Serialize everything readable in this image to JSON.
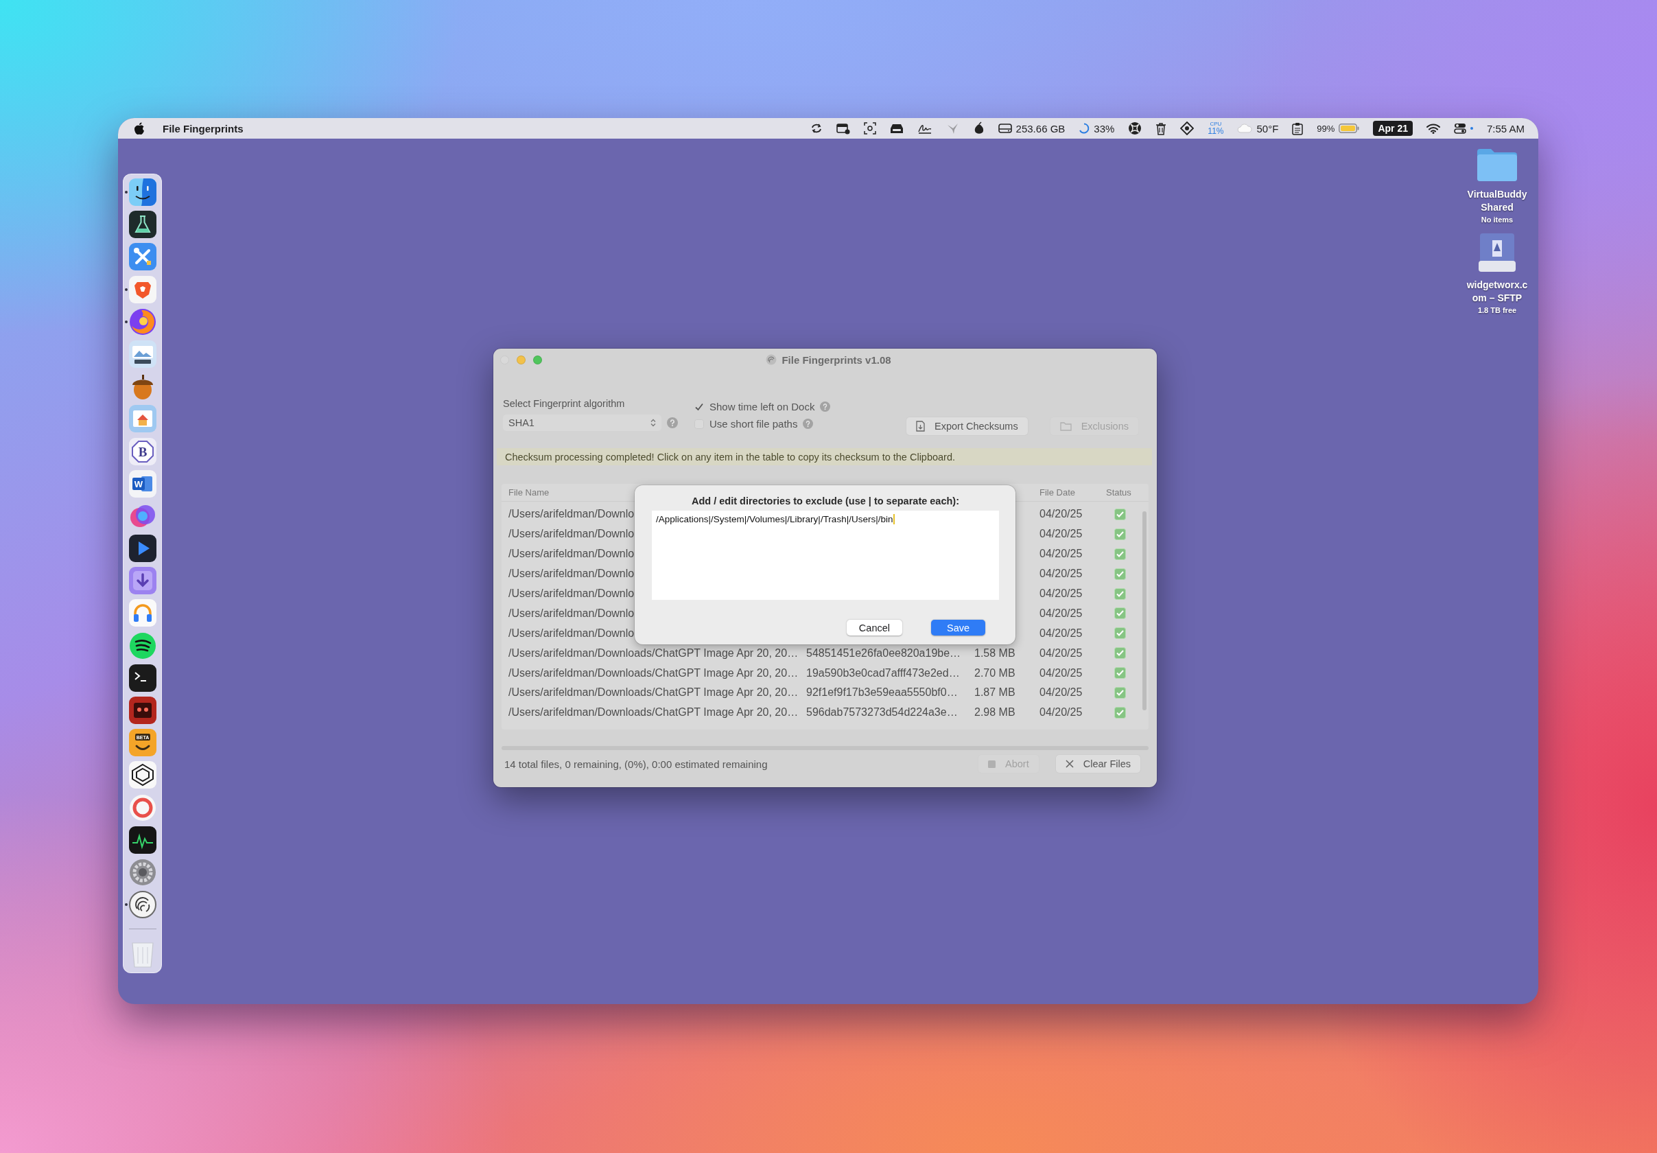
{
  "menu_bar": {
    "app_name": "File Fingerprints",
    "disk_free": "253.66 GB",
    "ring_reading": "33%",
    "cpu_label": "CPU",
    "cpu_reading": "11%",
    "temperature": "50°F",
    "battery": "99%",
    "date": "Apr 21",
    "time": "7:55 AM"
  },
  "dock": {
    "items": [
      {
        "running": true
      },
      {
        "running": false
      },
      {
        "running": false
      },
      {
        "running": true
      },
      {
        "running": true
      },
      {
        "running": false
      },
      {
        "running": false
      },
      {
        "running": false
      },
      {
        "running": false,
        "text": "B"
      },
      {
        "running": false,
        "text": "W"
      },
      {
        "running": false
      },
      {
        "running": false
      },
      {
        "running": false
      },
      {
        "running": false
      },
      {
        "running": false
      },
      {
        "running": false
      },
      {
        "running": false
      },
      {
        "running": false,
        "text": "BETA"
      },
      {
        "running": false
      },
      {
        "running": false
      },
      {
        "running": false
      },
      {
        "running": false
      },
      {
        "running": true
      }
    ]
  },
  "desktop_items": [
    {
      "kind": "folder",
      "name": "VirtualBuddy Shared",
      "detail": "No items"
    },
    {
      "kind": "drive",
      "name": "widgetworx.com – SFTP",
      "detail": "1.8 TB free"
    }
  ],
  "window": {
    "title": "File Fingerprints v1.08",
    "traffic_lights": [
      {
        "kind": "close",
        "enabled": false
      },
      {
        "kind": "minimize",
        "enabled": true
      },
      {
        "kind": "zoom",
        "enabled": true
      }
    ],
    "algorithm": {
      "label": "Select Fingerprint algorithm",
      "value": "SHA1"
    },
    "options": [
      {
        "label": "Show time left on Dock",
        "checked": true
      },
      {
        "label": "Use short file paths",
        "checked": false
      }
    ],
    "toolbar_buttons": [
      {
        "kind": "export",
        "label": "Export Checksums",
        "disabled": false
      },
      {
        "kind": "exclusions",
        "label": "Exclusions",
        "disabled": true
      }
    ],
    "message": "Checksum processing completed! Click on any item in the table to copy its checksum to the Clipboard.",
    "table": {
      "header": {
        "file_name": "File Name",
        "file_date": "File Date",
        "status": "Status"
      },
      "rows": [
        {
          "file_name": "/Users/arifeldman/Downlo",
          "file_date": "04/20/25",
          "complete": true
        },
        {
          "file_name": "/Users/arifeldman/Downlo",
          "file_date": "04/20/25",
          "complete": true
        },
        {
          "file_name": "/Users/arifeldman/Downlo",
          "file_date": "04/20/25",
          "complete": true
        },
        {
          "file_name": "/Users/arifeldman/Downlo",
          "file_date": "04/20/25",
          "complete": true
        },
        {
          "file_name": "/Users/arifeldman/Downlo",
          "file_date": "04/20/25",
          "complete": true
        },
        {
          "file_name": "/Users/arifeldman/Downlo",
          "file_date": "04/20/25",
          "complete": true
        },
        {
          "file_name": "/Users/arifeldman/Downlo",
          "file_date": "04/20/25",
          "complete": true
        },
        {
          "file_name": "/Users/arifeldman/Downloads/ChatGPT Image Apr 20, 20…",
          "checksum": "54851451e26fa0ee820a19be…",
          "size": "1.58 MB",
          "file_date": "04/20/25",
          "complete": true
        },
        {
          "file_name": "/Users/arifeldman/Downloads/ChatGPT Image Apr 20, 20…",
          "checksum": "19a590b3e0cad7afff473e2ed…",
          "size": "2.70 MB",
          "file_date": "04/20/25",
          "complete": true
        },
        {
          "file_name": "/Users/arifeldman/Downloads/ChatGPT Image Apr 20, 20…",
          "checksum": "92f1ef9f17b3e59eaa5550bf0…",
          "size": "1.87 MB",
          "file_date": "04/20/25",
          "complete": true
        },
        {
          "file_name": "/Users/arifeldman/Downloads/ChatGPT Image Apr 20, 20…",
          "checksum": "596dab7573273d54d224a3e…",
          "size": "2.98 MB",
          "file_date": "04/20/25",
          "complete": true
        }
      ]
    },
    "status_text": "14 total files, 0 remaining, (0%), 0:00 estimated remaining",
    "footer_buttons": [
      {
        "kind": "stop",
        "label": "Abort",
        "disabled": true
      },
      {
        "kind": "clear",
        "label": "Clear Files",
        "disabled": false
      }
    ],
    "dialog": {
      "title": "Add / edit directories to exclude (use | to separate each):",
      "value": "/Applications|/System|/Volumes|/Library|/Trash|/Users|/bin",
      "buttons": [
        {
          "label": "Cancel",
          "default": false
        },
        {
          "label": "Save",
          "default": true
        }
      ]
    }
  }
}
